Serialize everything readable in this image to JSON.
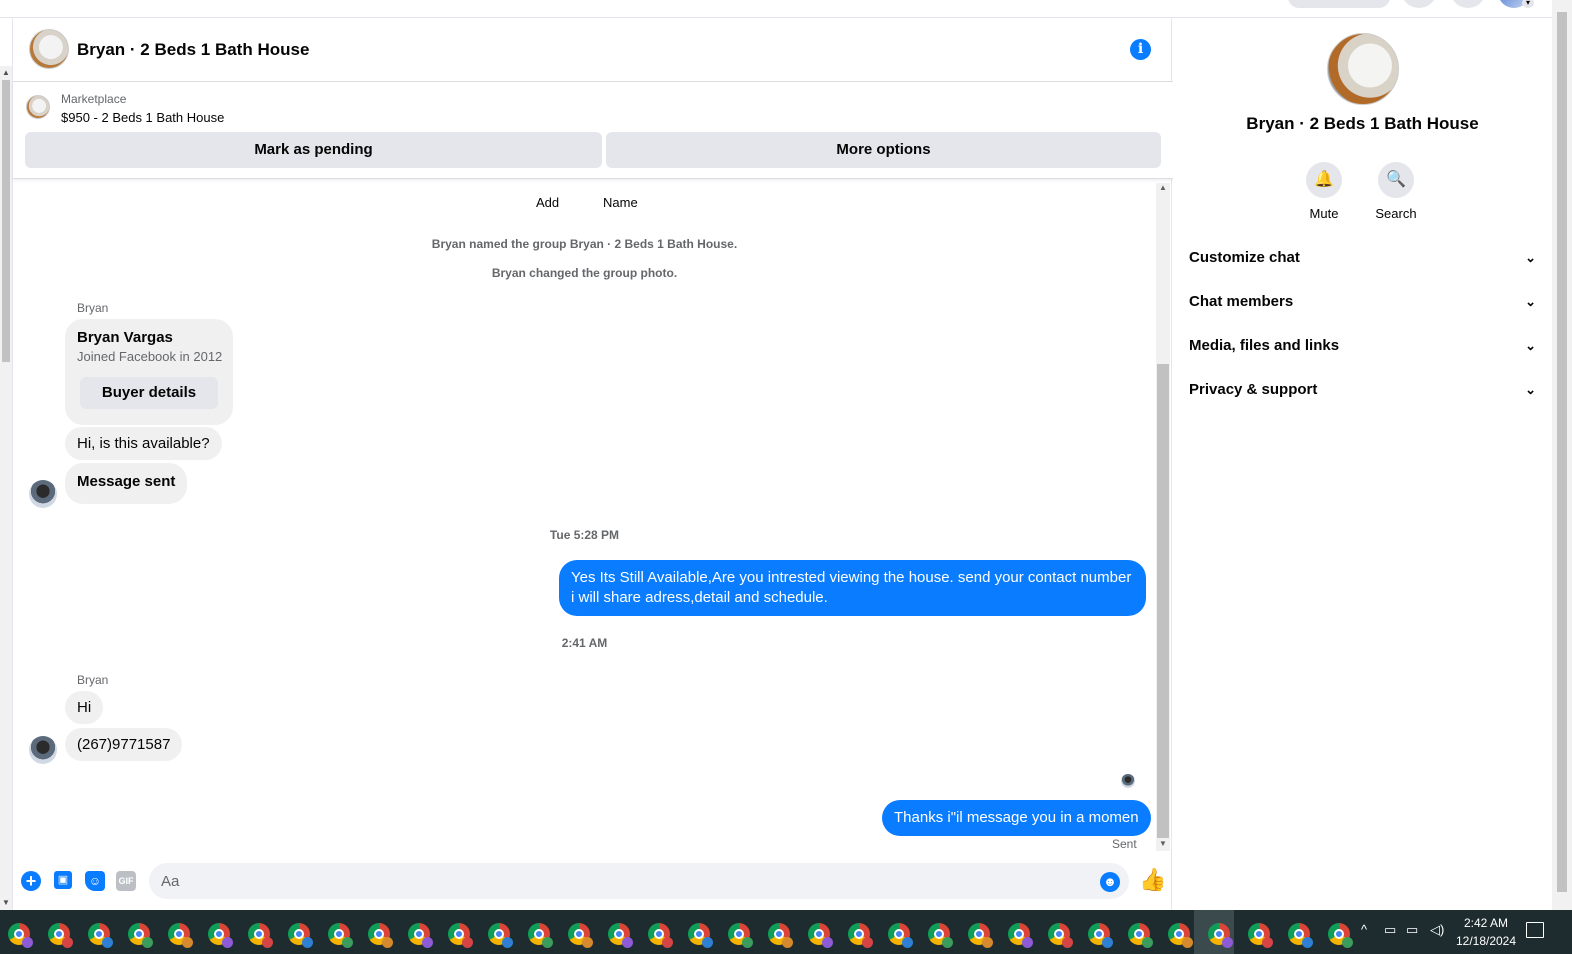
{
  "chat": {
    "title": "Bryan · 2 Beds 1 Bath House",
    "info_icon": "info-icon",
    "marketplace": {
      "label": "Marketplace",
      "listing": "$950 - 2 Beds 1 Bath House",
      "mark_pending_label": "Mark as pending",
      "more_options_label": "More options"
    },
    "messages": {
      "top_add": "Add",
      "top_name": "Name",
      "sys_named": "Bryan named the group Bryan · 2 Beds 1 Bath House.",
      "sys_photo": "Bryan changed the group photo.",
      "sender_1": "Bryan",
      "card_name": "Bryan Vargas",
      "card_sub": "Joined Facebook in 2012",
      "card_button": "Buyer details",
      "in_1": "Hi, is this available?",
      "in_2": "Message sent",
      "ts_1": "Tue 5:28 PM",
      "out_1": "Yes Its Still Available,Are you intrested viewing the house. send your contact number i will share adress,detail and schedule.",
      "ts_2": "2:41 AM",
      "sender_2": "Bryan",
      "in_3": "Hi",
      "in_4": "(267)9771587",
      "out_2": "Thanks i\"il message you in a momen",
      "sent_status": "Sent"
    },
    "composer": {
      "placeholder": "Aa"
    }
  },
  "sidebar": {
    "title": "Bryan · 2 Beds 1 Bath House",
    "actions": [
      {
        "label": "Mute",
        "icon": "bell-icon"
      },
      {
        "label": "Search",
        "icon": "search-icon"
      }
    ],
    "sections": [
      {
        "label": "Customize chat"
      },
      {
        "label": "Chat members"
      },
      {
        "label": "Media, files and links"
      },
      {
        "label": "Privacy & support"
      }
    ]
  },
  "taskbar": {
    "time": "2:42 AM",
    "date": "12/18/2024"
  },
  "colors": {
    "accent": "#0a7cff",
    "bubble_in": "#f0f0f0",
    "button_bg": "#e4e6eb",
    "taskbar": "#1f2c2f"
  }
}
